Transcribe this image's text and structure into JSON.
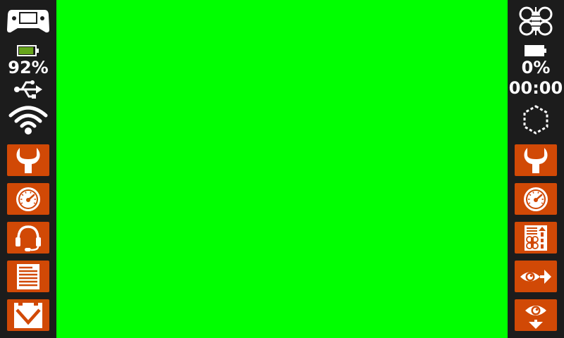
{
  "colors": {
    "background": "#00ff00",
    "sidebar": "#1c1c1c",
    "button": "#d14906",
    "icon": "#ffffff",
    "battery_fill": "#67a51c"
  },
  "left_panel": {
    "controller_icon": "gamepad-icon",
    "battery_percent": "92%",
    "battery_level": 0.92,
    "usb_icon": "usb-icon",
    "wifi_icon": "wifi-icon",
    "buttons": [
      {
        "icon": "wrench-icon"
      },
      {
        "icon": "gauge-icon"
      },
      {
        "icon": "headset-icon"
      },
      {
        "icon": "document-icon"
      },
      {
        "icon": "collapse-icon"
      }
    ]
  },
  "right_panel": {
    "drone_icon": "drone-icon",
    "battery_percent": "0%",
    "battery_level": 0,
    "flight_time": "00:00",
    "geofence_icon": "dashed-hexagon-icon",
    "buttons": [
      {
        "icon": "wrench-icon"
      },
      {
        "icon": "gauge-icon"
      },
      {
        "icon": "drone-checklist-icon"
      },
      {
        "icon": "eye-forward-icon"
      },
      {
        "icon": "eye-down-icon"
      }
    ]
  }
}
